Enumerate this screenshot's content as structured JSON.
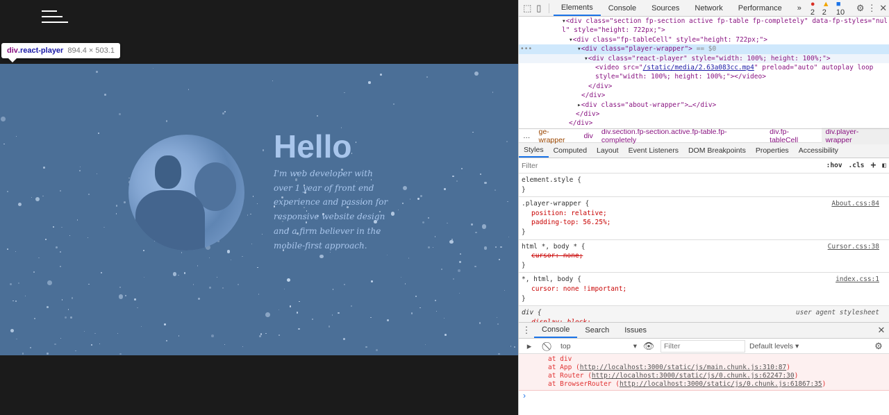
{
  "page": {
    "hello": "Hello",
    "bio": "I'm web developer with over 1 year of front end experience and passion for responsive website design and a firm believer in the mobile-first approach."
  },
  "tooltip": {
    "tag": "div",
    "cls": ".react-player",
    "size": "894.4 × 503.1"
  },
  "devtools": {
    "tabs": [
      "Elements",
      "Console",
      "Sources",
      "Network",
      "Performance"
    ],
    "more": "»",
    "errors": "2",
    "warnings": "2",
    "messages": "10",
    "tree": {
      "l1a": "<div class=\"section fp-section active fp-table fp-completely\" data-fp-styles=\"nul",
      "l1b": "l\" style=\"height: 722px;\">",
      "l2": "<div class=\"fp-tableCell\" style=\"height: 722px;\">",
      "l3": "<div class=\"player-wrapper\">",
      "l3s": " == $0",
      "l4": "<div class=\"react-player\" style=\"width: 100%; height: 100%;\">",
      "l5a": "<video src=\"",
      "l5link": "/static/media/2.63a083cc.mp4",
      "l5b": "\" preload=\"auto\" autoplay loop",
      "l6": "style=\"width: 100%; height: 100%;\"></video>",
      "l7": "</div>",
      "l8": "</div>",
      "l9": "<div class=\"about-wrapper\">…</div>",
      "l10": "</div>",
      "l11": "</div>"
    },
    "breadcrumbs": [
      "ge-wrapper",
      "div",
      "div.section.fp-section.active.fp-table.fp-completely",
      "div.fp-tableCell",
      "div.player-wrapper"
    ],
    "style_tabs": [
      "Styles",
      "Computed",
      "Layout",
      "Event Listeners",
      "DOM Breakpoints",
      "Properties",
      "Accessibility"
    ],
    "filter_placeholder": "Filter",
    "hov": ":hov",
    "cls": ".cls",
    "rules": [
      {
        "sel": "element.style {",
        "props": [],
        "src": ""
      },
      {
        "sel": ".player-wrapper {",
        "props": [
          "position: relative;",
          "padding-top: 56.25%;"
        ],
        "src": "About.css:84"
      },
      {
        "sel": "html *, body * {",
        "props": [
          "cursor: none;"
        ],
        "src": "Cursor.css:38",
        "struck": true
      },
      {
        "sel": "*, html, body {",
        "props": [
          "cursor: none !important;"
        ],
        "src": "index.css:1"
      },
      {
        "sel": "div {",
        "props": [
          "display: block;"
        ],
        "src": "user agent stylesheet"
      }
    ],
    "drawer_tabs": [
      "Console",
      "Search",
      "Issues"
    ],
    "context": "top",
    "console_filter": "Filter",
    "levels": "Default levels ▾",
    "stack": [
      {
        "pre": "at div",
        "url": ""
      },
      {
        "pre": "at App (",
        "url": "http://localhost:3000/static/js/main.chunk.js:310:87"
      },
      {
        "pre": "at Router (",
        "url": "http://localhost:3000/static/js/0.chunk.js:62247:30"
      },
      {
        "pre": "at BrowserRouter (",
        "url": "http://localhost:3000/static/js/0.chunk.js:61867:35"
      }
    ]
  }
}
